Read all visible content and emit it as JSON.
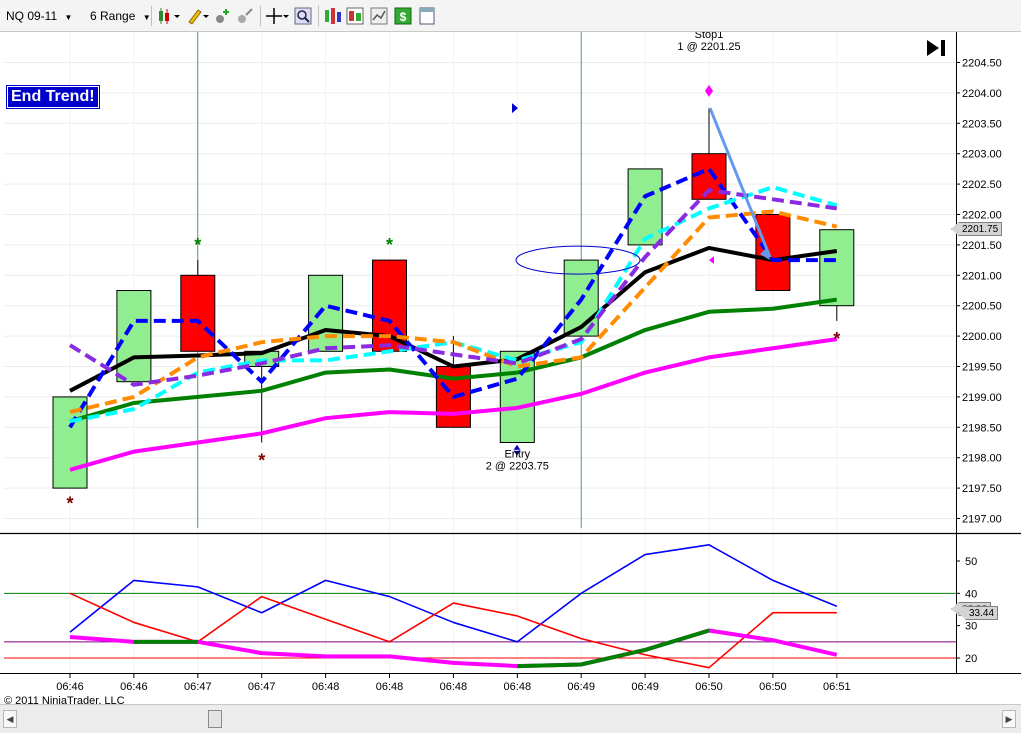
{
  "toolbar": {
    "instrument": "NQ 09-11",
    "period": "6 Range",
    "buttons": [
      "bar-style-icon",
      "drawing-tools-icon",
      "add-indicator-icon",
      "add-strategy-icon",
      "crosshair-icon",
      "zoom-icon",
      "data-box-icon",
      "chart-trader-icon",
      "properties-icon",
      "order-icon"
    ]
  },
  "overlays": {
    "end_trend_label": "End Trend!",
    "copyright": "© 2011 NinjaTrader, LLC",
    "price_tag_main": "2201.75",
    "price_tag_ind_back": "36.86",
    "price_tag_ind_front": "33.44"
  },
  "colors": {
    "up_candle": "#90ee90",
    "down_candle": "#ff0000",
    "ema_green": "#008000",
    "ema_magenta": "#ff00ff",
    "ema_black": "#000000",
    "ma_blue": "#0000ff",
    "ma_cyan": "#00ffff",
    "ma_orange": "#ff8c00",
    "ma_purple": "#8a2be2",
    "ind_blue": "#0000ff",
    "ind_red": "#ff0000",
    "ind_adx": "#ff00ff",
    "ind_adx_up": "#008000"
  },
  "chart_data": {
    "type": "candlestick",
    "times": [
      "06:46",
      "06:46",
      "06:47",
      "06:47",
      "06:48",
      "06:48",
      "06:48",
      "06:48",
      "06:49",
      "06:49",
      "06:50",
      "06:50",
      "06:51"
    ],
    "ohlc": [
      {
        "o": 2197.5,
        "h": 2199.0,
        "l": 2197.5,
        "c": 2199.0
      },
      {
        "o": 2199.25,
        "h": 2200.75,
        "l": 2199.25,
        "c": 2200.75
      },
      {
        "o": 2201.0,
        "h": 2201.25,
        "l": 2199.75,
        "c": 2199.75
      },
      {
        "o": 2199.5,
        "h": 2199.75,
        "l": 2198.25,
        "c": 2199.75
      },
      {
        "o": 2199.75,
        "h": 2201.0,
        "l": 2199.75,
        "c": 2201.0
      },
      {
        "o": 2201.25,
        "h": 2201.25,
        "l": 2199.75,
        "c": 2199.75
      },
      {
        "o": 2199.5,
        "h": 2200.0,
        "l": 2198.5,
        "c": 2198.5
      },
      {
        "o": 2198.25,
        "h": 2199.75,
        "l": 2198.25,
        "c": 2199.75
      },
      {
        "o": 2200.0,
        "h": 2201.25,
        "l": 2200.0,
        "c": 2201.25
      },
      {
        "o": 2201.5,
        "h": 2202.75,
        "l": 2201.5,
        "c": 2202.75
      },
      {
        "o": 2203.0,
        "h": 2203.75,
        "l": 2202.25,
        "c": 2202.25
      },
      {
        "o": 2202.0,
        "h": 2202.0,
        "l": 2200.75,
        "c": 2200.75
      },
      {
        "o": 2200.5,
        "h": 2201.75,
        "l": 2200.25,
        "c": 2201.75
      }
    ],
    "price_axis": {
      "min": 2197.0,
      "max": 2204.5,
      "step": 0.5,
      "labels": [
        "2197.00",
        "2197.50",
        "2198.00",
        "2198.50",
        "2199.00",
        "2199.50",
        "2200.00",
        "2200.50",
        "2201.00",
        "2201.50",
        "2202.00",
        "2202.50",
        "2203.00",
        "2203.50",
        "2204.00",
        "2204.50"
      ]
    },
    "series": [
      {
        "name": "",
        "color": "#008000",
        "style": "solid",
        "values": [
          2198.6,
          2198.9,
          2199.0,
          2199.1,
          2199.4,
          2199.45,
          2199.3,
          2199.4,
          2199.65,
          2200.1,
          2200.4,
          2200.45,
          2200.6
        ]
      },
      {
        "name": "",
        "color": "#ff00ff",
        "style": "solid",
        "values": [
          2197.8,
          2198.1,
          2198.25,
          2198.4,
          2198.65,
          2198.75,
          2198.72,
          2198.82,
          2199.05,
          2199.4,
          2199.65,
          2199.8,
          2199.95
        ]
      },
      {
        "name": "",
        "color": "#000000",
        "style": "solid",
        "values": [
          2199.1,
          2199.65,
          2199.68,
          2199.72,
          2200.1,
          2200.0,
          2199.5,
          2199.62,
          2200.15,
          2201.05,
          2201.45,
          2201.25,
          2201.4
        ]
      },
      {
        "name": "",
        "color": "#0000ff",
        "style": "dashed",
        "values": [
          2198.5,
          2200.25,
          2200.25,
          2199.25,
          2200.5,
          2200.25,
          2199.0,
          2199.3,
          2200.6,
          2202.3,
          2202.75,
          2201.25,
          2201.25
        ]
      },
      {
        "name": "",
        "color": "#00ffff",
        "style": "dashed",
        "values": [
          2198.6,
          2198.8,
          2199.4,
          2199.6,
          2199.6,
          2199.75,
          2199.9,
          2199.6,
          2199.9,
          2201.6,
          2202.1,
          2202.45,
          2202.15
        ]
      },
      {
        "name": "",
        "color": "#ff8c00",
        "style": "dashed",
        "values": [
          2198.75,
          2199.0,
          2199.65,
          2199.9,
          2200.0,
          2200.0,
          2199.9,
          2199.5,
          2199.65,
          2200.8,
          2201.95,
          2202.05,
          2201.8
        ]
      },
      {
        "name": "",
        "color": "#8a2be2",
        "style": "dashed",
        "values": [
          2199.85,
          2199.2,
          2199.35,
          2199.55,
          2199.8,
          2199.85,
          2199.7,
          2199.55,
          2199.95,
          2201.3,
          2202.4,
          2202.25,
          2202.1
        ]
      }
    ],
    "markers": [
      {
        "bar": 0,
        "price": 2197.25,
        "symbol": "*",
        "color": "#800000"
      },
      {
        "bar": 2,
        "price": 2201.5,
        "symbol": "*",
        "color": "#008000"
      },
      {
        "bar": 3,
        "price": 2197.95,
        "symbol": "*",
        "color": "#800000"
      },
      {
        "bar": 5,
        "price": 2201.5,
        "symbol": "*",
        "color": "#008000"
      },
      {
        "bar": 12,
        "price": 2199.95,
        "symbol": "*",
        "color": "#800000"
      }
    ],
    "annotations": [
      {
        "bar": 7,
        "price": 2198.0,
        "lines": [
          "Entry",
          "2 @ 2203.75"
        ]
      },
      {
        "bar": 10,
        "price": 2205.3,
        "lines": [
          "Stop1",
          "1 @ 2201.25",
          "Stop1",
          "1 @ 2201.25"
        ]
      }
    ],
    "indicator": {
      "axis": {
        "labels": [
          "20",
          "30",
          "40",
          "50"
        ],
        "values": [
          20,
          30,
          40,
          50
        ],
        "min": 15,
        "max": 58
      },
      "hlines": [
        {
          "value": 40,
          "color": "#008000"
        },
        {
          "value": 25,
          "color": "#800080"
        },
        {
          "value": 20,
          "color": "#ff0000"
        }
      ],
      "series": [
        {
          "name": "",
          "color": "#0000ff",
          "values": [
            28,
            44,
            42,
            34,
            44,
            39,
            31,
            25,
            40,
            52,
            55,
            44,
            36
          ]
        },
        {
          "name": "",
          "color": "#ff0000",
          "values": [
            40,
            31,
            25,
            39,
            32,
            25,
            37,
            33,
            26,
            21,
            17,
            34,
            34
          ]
        },
        {
          "name": "",
          "color": "#ff00ff",
          "values": [
            26.5,
            25,
            25,
            21.5,
            20.5,
            20.5,
            18.5,
            17.5,
            18,
            22.5,
            28.5,
            25.5,
            21
          ]
        }
      ],
      "adx_green_segments": [
        [
          1,
          2
        ],
        [
          7,
          10
        ]
      ]
    }
  }
}
